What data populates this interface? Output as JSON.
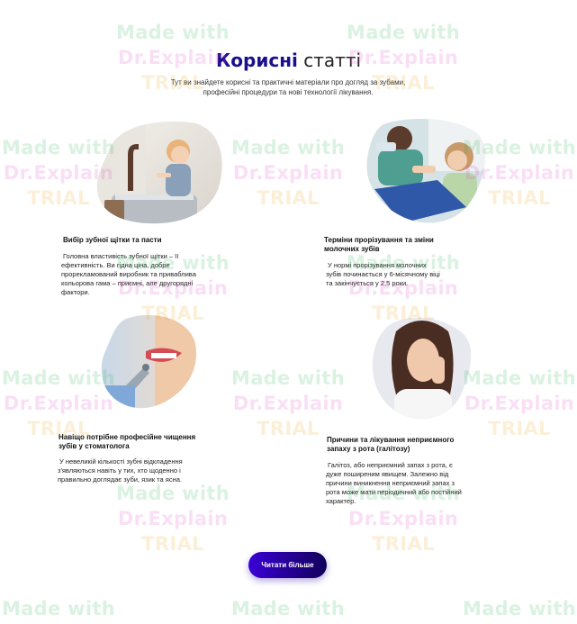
{
  "heading": {
    "accent": "Корисні",
    "rest": "статті"
  },
  "subtitle": "Тут ви знайдете корисні та практичні матеріали про догляд за зубами, професійні процедури та нові технології лікування.",
  "articles": [
    {
      "title": "Вибір зубної щітки та пасти",
      "text": "Головна властивість зубної щітки – її ефективність. Ви гідна ціна, добре прорекламований виробник та приваблива кольорова гама – приємні, але другорядні фактори.",
      "image_icon": "child-brushing-teeth-photo"
    },
    {
      "title": "Терміни прорізування та зміни молочних зубів",
      "text": "У нормі прорізування молочних зубів починається у 6-місячному віці та закінчується у 2,5 роки.",
      "image_icon": "girl-at-dentist-photo"
    },
    {
      "title": "Навіщо потрібне професійне чищення зубів у стоматолога",
      "text": "У невеликій кількості зубні відкладення з'являються навіть у тих, хто щоденно і правильно доглядає зуби, язик та ясна.",
      "image_icon": "smile-dental-tool-photo"
    },
    {
      "title": "Причини та лікування неприємного запаху з рота (галітозу)",
      "text": "Галітоз, або неприємний запах з рота, є дуже поширеним явищем. Залежно від причини виникнення неприємний запах з рота може мати періодичний або постійний характер.",
      "image_icon": "woman-toothache-photo"
    }
  ],
  "button": {
    "label": "Читати більше"
  },
  "watermark": {
    "line1": "Made with",
    "line2": "Dr.Explain",
    "line3": "TRIAL"
  },
  "colors": {
    "accent": "#1a0f8c",
    "button_from": "#3a00d6",
    "button_to": "#12005a"
  }
}
